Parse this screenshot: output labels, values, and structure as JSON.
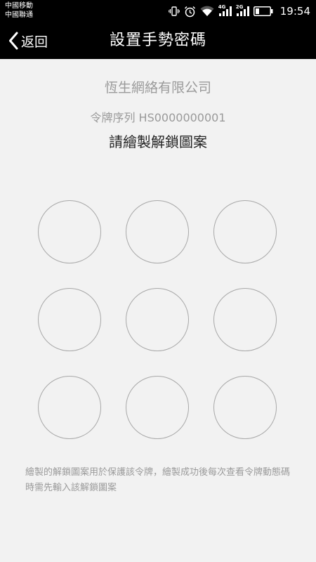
{
  "status_bar": {
    "carrier_1": "中國移動",
    "carrier_2": "中國聯通",
    "network_1": "4G",
    "network_2": "2G",
    "time": "19:54",
    "icons": [
      "vibrate-icon",
      "alarm-icon",
      "wifi-icon",
      "signal-4g-icon",
      "signal-2g-icon",
      "battery-icon"
    ]
  },
  "title_bar": {
    "back_label": "返回",
    "title": "設置手勢密碼"
  },
  "content": {
    "company_name": "恆生網絡有限公司",
    "token_serial": "令牌序列 HS0000000001",
    "instruction": "請繪製解鎖圖案",
    "hint": "繪製的解鎖圖案用於保護該令牌，繪製成功後每次查看令牌動態碼時需先輸入該解鎖圖案"
  },
  "pattern": {
    "rows": 3,
    "cols": 3
  },
  "colors": {
    "bar_background": "#000000",
    "page_background": "#f2f2f2",
    "dot_border": "#a8a8a8",
    "muted_text": "#9a9a9a"
  }
}
